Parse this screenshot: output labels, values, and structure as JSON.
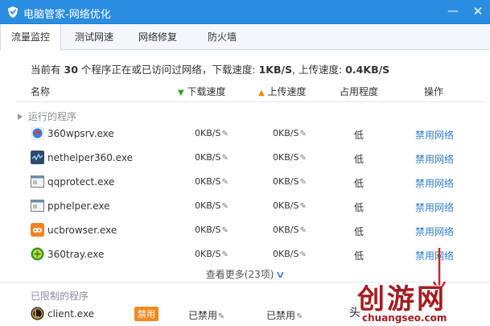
{
  "window": {
    "title": "电脑管家-网络优化",
    "minimize_glyph": "—",
    "close_glyph": "✕"
  },
  "tabs": [
    {
      "label": "流量监控",
      "active": true
    },
    {
      "label": "测试网速",
      "active": false
    },
    {
      "label": "网络修复",
      "active": false
    },
    {
      "label": "防火墙",
      "active": false
    }
  ],
  "summary": {
    "prefix": "当前有",
    "count": "30",
    "middle": "个程序正在或已访问过网络，下载速度:",
    "download_speed": "1KB/S",
    "upload_label": ", 上传速度:",
    "upload_speed": "0.4KB/S"
  },
  "columns": {
    "name": "名称",
    "download": "下载速度",
    "upload": "上传速度",
    "usage": "占用程度",
    "action": "操作"
  },
  "running_group": {
    "label": "运行的程序",
    "rows": [
      {
        "name": "360wpsrv.exe",
        "download": "0KB/S",
        "upload": "0KB/S",
        "usage": "低",
        "action": "禁用网络",
        "icon": "360-safeguard-icon"
      },
      {
        "name": "nethelper360.exe",
        "download": "0KB/S",
        "upload": "0KB/S",
        "usage": "低",
        "action": "禁用网络",
        "icon": "network-helper-icon"
      },
      {
        "name": "qqprotect.exe",
        "download": "0KB/S",
        "upload": "0KB/S",
        "usage": "低",
        "action": "禁用网络",
        "icon": "generic-window-icon"
      },
      {
        "name": "pphelper.exe",
        "download": "0KB/S",
        "upload": "0KB/S",
        "usage": "低",
        "action": "禁用网络",
        "icon": "generic-window-icon"
      },
      {
        "name": "ucbrowser.exe",
        "download": "0KB/S",
        "upload": "0KB/S",
        "usage": "低",
        "action": "禁用网络",
        "icon": "uc-browser-icon"
      },
      {
        "name": "360tray.exe",
        "download": "0KB/S",
        "upload": "0KB/S",
        "usage": "低",
        "action": "禁用网络",
        "icon": "360-tray-icon"
      }
    ],
    "more_label": "查看更多(23项)"
  },
  "restricted_group": {
    "label": "已限制的程序",
    "rows": [
      {
        "name": "client.exe",
        "badge": "禁用",
        "download": "已禁用",
        "upload": "已禁用",
        "icon": "game-client-icon"
      }
    ]
  },
  "watermark": {
    "chinese": "创游网",
    "domain": "chuangseo.com",
    "partial_text": "头"
  },
  "colors": {
    "titlebar": "#2b8de0",
    "link": "#2d7dd2",
    "badge": "#f28a21",
    "watermark": "#a51c1f"
  }
}
